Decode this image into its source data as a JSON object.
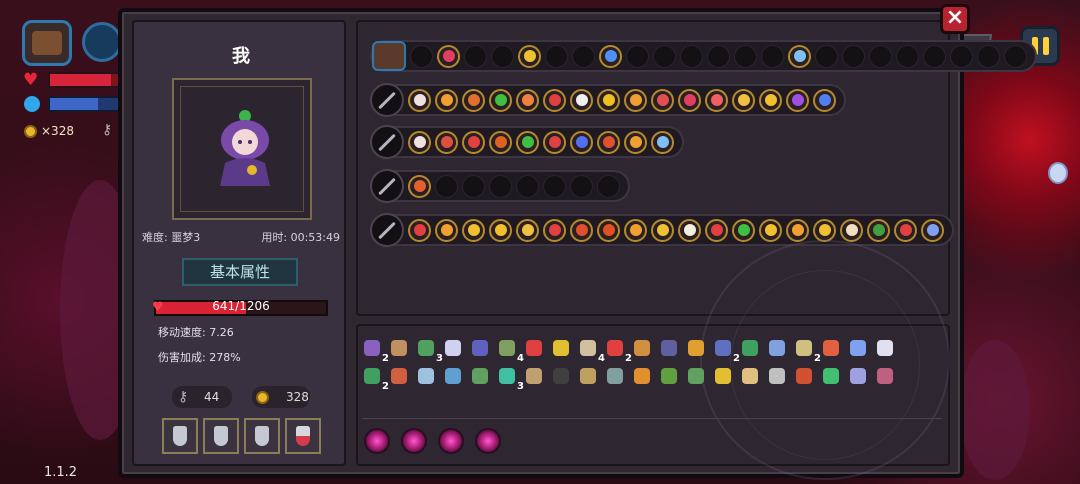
{
  "hud": {
    "coins": "×328",
    "version": "1.1.2",
    "health_fill": 0.9,
    "mana_fill": 0.7
  },
  "character": {
    "name": "我",
    "difficulty": "难度: 噩梦3",
    "time": "用时: 00:53:49",
    "attr_button": "基本属性",
    "hp_text": "641/1206",
    "hp_fraction": 0.53,
    "move_speed": "移动速度: 7.26",
    "damage_bonus": "伤害加成: 278%",
    "keys": "44",
    "coins": "328"
  },
  "help_button": "?",
  "close_button": "×",
  "wands": {
    "bag_slots": 23,
    "bag_filled": [
      1,
      4,
      7,
      14
    ],
    "rows": [
      {
        "name": "wand-1",
        "slots": 16,
        "colors": [
          "#f0e0e0",
          "#f0a030",
          "#e07030",
          "#40c040",
          "#f08040",
          "#e04040",
          "#f0f0f0",
          "#f0c020",
          "#f0a030",
          "#e05050",
          "#e04060",
          "#f06060",
          "#f0c040",
          "#f0c030",
          "#a050e0",
          "#5080f0"
        ]
      },
      {
        "name": "wand-2",
        "slots": 10,
        "colors": [
          "#f0e0e0",
          "#e05040",
          "#e04040",
          "#e06020",
          "#40c040",
          "#e04040",
          "#5070f0",
          "#e05030",
          "#f0a030",
          "#80c0f0"
        ]
      },
      {
        "name": "wand-3",
        "slots": 8,
        "colors": [
          "#e06030"
        ]
      },
      {
        "name": "wand-4",
        "slots": 20,
        "colors": [
          "#e04040",
          "#f0a030",
          "#f0c030",
          "#f0c030",
          "#f0c040",
          "#e04040",
          "#e05030",
          "#e05020",
          "#f0a030",
          "#f0c030",
          "#f0f0e0",
          "#e04040",
          "#40c040",
          "#f0c030",
          "#f0a030",
          "#f0c030",
          "#f0e0c0",
          "#40a040",
          "#e04040",
          "#80a0f0",
          "#80c0f0"
        ]
      }
    ]
  },
  "inventory": {
    "items": [
      {
        "c": "#8a60c0",
        "n": "2"
      },
      {
        "c": "#c09060"
      },
      {
        "c": "#50a060",
        "n": "3"
      },
      {
        "c": "#d0d0f0"
      },
      {
        "c": "#6060c0"
      },
      {
        "c": "#80a060",
        "n": "4"
      },
      {
        "c": "#e04040"
      },
      {
        "c": "#e0c030"
      },
      {
        "c": "#d0c0a0",
        "n": "4"
      },
      {
        "c": "#e04040",
        "n": "2"
      },
      {
        "c": "#d09040"
      },
      {
        "c": "#6060a0"
      },
      {
        "c": "#e0a030"
      },
      {
        "c": "#6070c0",
        "n": "2"
      },
      {
        "c": "#40a060"
      },
      {
        "c": "#80a0e0"
      },
      {
        "c": "#d0c080",
        "n": "2"
      },
      {
        "c": "#e06040"
      },
      {
        "c": "#80a0f0"
      },
      {
        "c": "#e0e0f0"
      },
      {
        "c": "#40a060",
        "n": "2"
      },
      {
        "c": "#d06040"
      },
      {
        "c": "#a0c0e0"
      },
      {
        "c": "#60a0d0"
      },
      {
        "c": "#60a060"
      },
      {
        "c": "#40c0a0",
        "n": "3"
      },
      {
        "c": "#c0a070"
      },
      {
        "c": "#404040"
      },
      {
        "c": "#c0a060"
      },
      {
        "c": "#80a0a0"
      },
      {
        "c": "#e09030"
      },
      {
        "c": "#60a040"
      },
      {
        "c": "#60a060"
      },
      {
        "c": "#e0c030"
      },
      {
        "c": "#e0c080"
      },
      {
        "c": "#c0c0c0"
      },
      {
        "c": "#d05030"
      },
      {
        "c": "#40c070"
      },
      {
        "c": "#a0a0e0"
      },
      {
        "c": "#c06080"
      }
    ],
    "orb_count": 4
  }
}
